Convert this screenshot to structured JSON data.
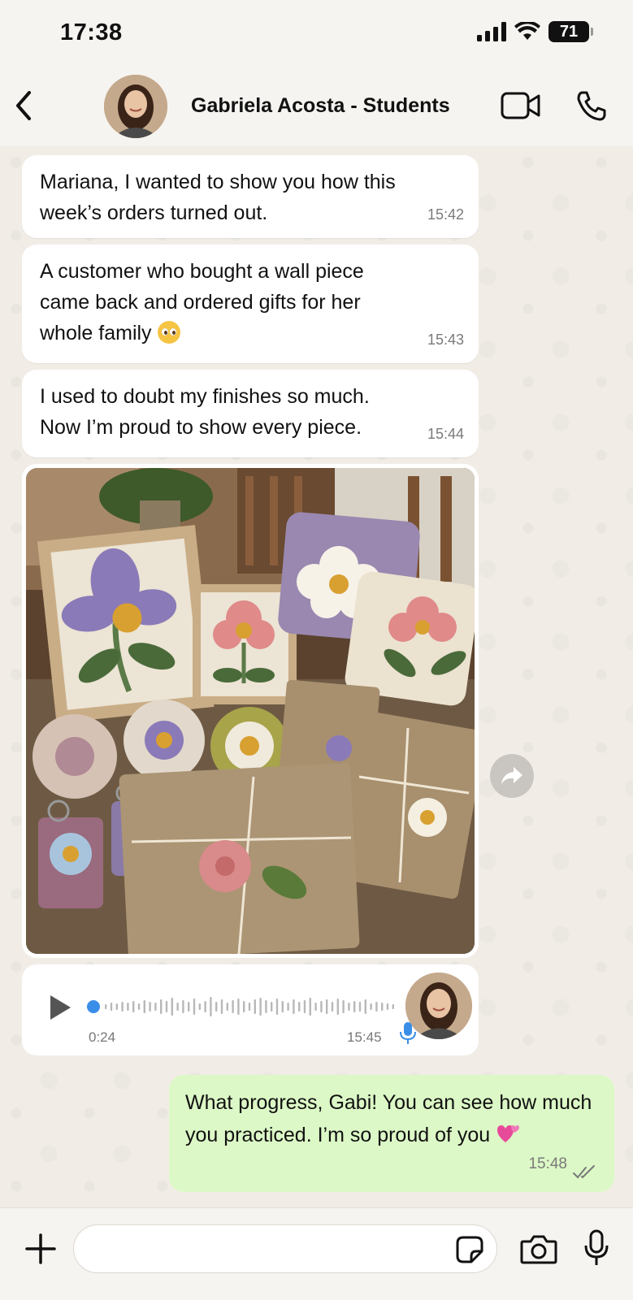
{
  "status_bar": {
    "time": "17:38",
    "battery": "71"
  },
  "header": {
    "contact_name": "Gabriela Acosta - Students"
  },
  "messages": [
    {
      "direction": "incoming",
      "text_lines": [
        "Mariana, I wanted to show you how this",
        "week’s orders turned out."
      ],
      "time": "15:42"
    },
    {
      "direction": "incoming",
      "text_lines": [
        "A customer who bought a wall piece",
        "came back and ordered gifts for her",
        "whole family"
      ],
      "emoji": "pleading-face",
      "time": "15:43"
    },
    {
      "direction": "incoming",
      "text_lines": [
        "I used to doubt my finishes so much.",
        "Now I’m proud to show every piece."
      ],
      "time": "15:44"
    },
    {
      "direction": "incoming",
      "type": "photo"
    },
    {
      "direction": "incoming",
      "type": "voice",
      "duration": "0:24",
      "time": "15:45",
      "progress": 0
    },
    {
      "direction": "outgoing",
      "text_lines": [
        "What progress, Gabi! You can see how much",
        "you practiced. I’m so proud of you"
      ],
      "emoji": "two-hearts",
      "time": "15:48",
      "status": "read"
    }
  ],
  "input": {
    "placeholder": ""
  },
  "colors": {
    "outgoing_bubble": "#dcf8c6",
    "incoming_bubble": "#ffffff",
    "voice_accent": "#3b8ee8",
    "background": "#f1ede6"
  },
  "icons": [
    "back-icon",
    "video-call-icon",
    "phone-icon",
    "forward-icon",
    "play-icon",
    "mic-icon",
    "read-ticks-icon",
    "plus-icon",
    "sticker-icon",
    "camera-icon"
  ]
}
